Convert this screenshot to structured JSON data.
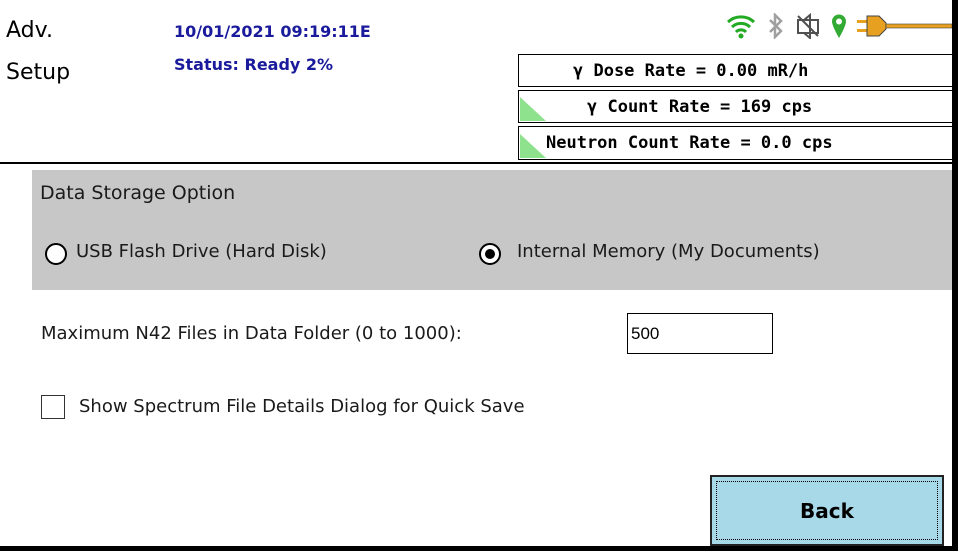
{
  "header": {
    "title_line1": "Adv.",
    "title_line2": "Setup",
    "datetime": "10/01/2021 09:19:11E",
    "status": "Status: Ready 2%"
  },
  "status_icons": {
    "wifi": "wifi-icon",
    "bluetooth": "bluetooth-icon",
    "sound": "speaker-muted-icon",
    "location": "location-pin-icon",
    "power": "power-plug-icon",
    "colors": {
      "wifi": "#22aa22",
      "bluetooth": "#a0a0a0",
      "sound": "#505050",
      "location": "#33aa33",
      "power": "#e8a020"
    }
  },
  "rates": {
    "gamma_dose": "γ Dose Rate = 0.00 mR/h",
    "gamma_count": "γ Count Rate = 169 cps",
    "neutron_count": "Neutron Count Rate = 0.0 cps"
  },
  "storage": {
    "heading": "Data Storage Option",
    "option_usb": "USB Flash Drive (Hard Disk)",
    "option_internal": "Internal Memory (My Documents)",
    "selected": "internal"
  },
  "max_files": {
    "label": "Maximum N42 Files in Data Folder (0 to 1000):",
    "value": "500"
  },
  "quick_save": {
    "label": "Show Spectrum File Details Dialog for Quick Save",
    "checked": false
  },
  "back_button": {
    "label": "Back"
  },
  "colors": {
    "header_text": "#1a1a9c",
    "panel_bg": "#c7c7c7",
    "button_bg": "#a8d9e8",
    "indicator": "#8ee28e"
  }
}
